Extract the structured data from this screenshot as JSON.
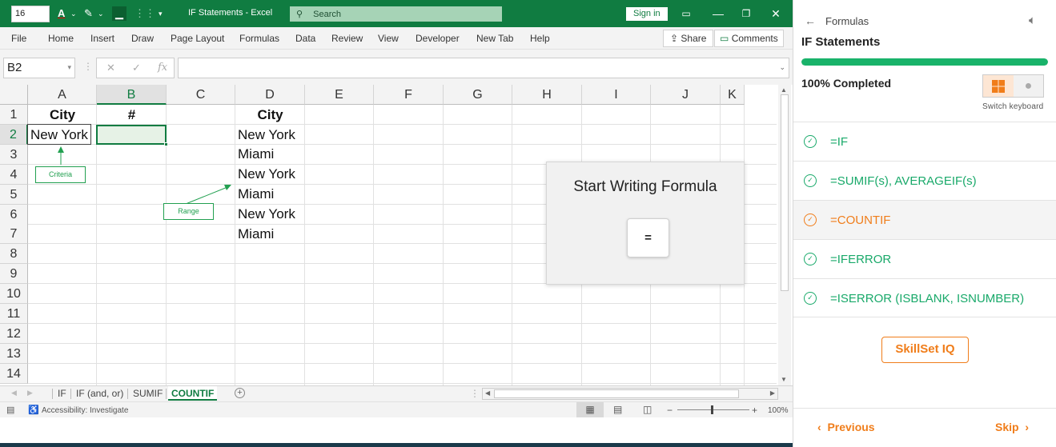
{
  "titlebar": {
    "font_size_value": "16",
    "doc_title": "IF Statements  -  Excel",
    "search_placeholder": "Search",
    "sign_in": "Sign in"
  },
  "menu": {
    "items": [
      "File",
      "Home",
      "Insert",
      "Draw",
      "Page Layout",
      "Formulas",
      "Data",
      "Review",
      "View",
      "Developer",
      "New Tab",
      "Help"
    ],
    "share": "Share",
    "comments": "Comments"
  },
  "formula_bar": {
    "name_box": "B2",
    "formula": ""
  },
  "grid": {
    "columns": [
      "A",
      "B",
      "C",
      "D",
      "E",
      "F",
      "G",
      "H",
      "I",
      "J",
      "K"
    ],
    "rows": [
      "1",
      "2",
      "3",
      "4",
      "5",
      "6",
      "7",
      "8",
      "9",
      "10",
      "11",
      "12",
      "13",
      "14"
    ],
    "selected_cell": "B2",
    "cells": {
      "A1": "City",
      "B1": "#",
      "A2": "New York",
      "D1": "City",
      "D2": "New York",
      "D3": "Miami",
      "D4": "New York",
      "D5": "Miami",
      "D6": "New York",
      "D7": "Miami"
    },
    "annotations": {
      "criteria": "Criteria",
      "range": "Range"
    },
    "accent_color": "#107c41"
  },
  "popup": {
    "title": "Start Writing Formula",
    "button": "="
  },
  "sheet_tabs": [
    "IF",
    "IF (and, or)",
    "SUMIF",
    "COUNTIF"
  ],
  "active_sheet": "COUNTIF",
  "status": {
    "accessibility": "Accessibility: Investigate",
    "zoom": "100%"
  },
  "panel": {
    "breadcrumb": "Formulas",
    "title": "IF Statements",
    "progress_fraction": 1.0,
    "progress_label": "100% Completed",
    "keyboard_label": "Switch keyboard",
    "topics": [
      {
        "label": "=IF",
        "state": "done"
      },
      {
        "label": "=SUMIF(s), AVERAGEIF(s)",
        "state": "done"
      },
      {
        "label": "=COUNTIF",
        "state": "active"
      },
      {
        "label": "=IFERROR",
        "state": "done"
      },
      {
        "label": "=ISERROR (ISBLANK, ISNUMBER)",
        "state": "done"
      }
    ],
    "skillset_button": "SkillSet IQ",
    "previous": "Previous",
    "skip": "Skip",
    "brand_color": "#f07d1a",
    "success_color": "#19a96a"
  }
}
